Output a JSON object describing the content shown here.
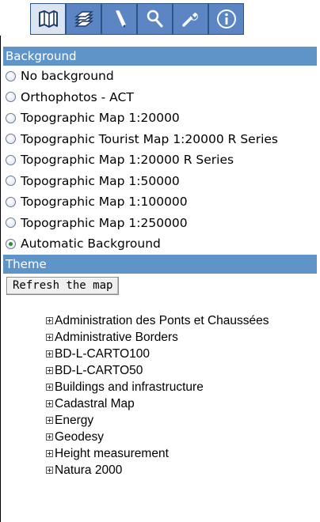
{
  "toolbar": {
    "tabs": [
      {
        "icon": "map-icon",
        "active": true
      },
      {
        "icon": "layers-icon",
        "active": false
      },
      {
        "icon": "pencil-icon",
        "active": false
      },
      {
        "icon": "search-icon",
        "active": false
      },
      {
        "icon": "wrench-icon",
        "active": false
      },
      {
        "icon": "info-icon",
        "active": false
      }
    ]
  },
  "background": {
    "header": "Background",
    "options": [
      {
        "label": "No background",
        "checked": false
      },
      {
        "label": "Orthophotos - ACT",
        "checked": false
      },
      {
        "label": "Topographic Map 1:20000",
        "checked": false
      },
      {
        "label": "Topographic Tourist Map 1:20000 R Series",
        "checked": false
      },
      {
        "label": "Topographic Map 1:20000 R Series",
        "checked": false
      },
      {
        "label": "Topographic Map 1:50000",
        "checked": false
      },
      {
        "label": "Topographic Map 1:100000",
        "checked": false
      },
      {
        "label": "Topographic Map 1:250000",
        "checked": false
      },
      {
        "label": "Automatic Background",
        "checked": true
      }
    ]
  },
  "theme": {
    "header": "Theme",
    "refresh_label": "Refresh the map",
    "items": [
      {
        "label": "Administration des Ponts et Chaussées"
      },
      {
        "label": "Administrative Borders"
      },
      {
        "label": "BD-L-CARTO100"
      },
      {
        "label": "BD-L-CARTO50"
      },
      {
        "label": "Buildings and infrastructure"
      },
      {
        "label": "Cadastral Map"
      },
      {
        "label": "Energy"
      },
      {
        "label": "Geodesy"
      },
      {
        "label": "Height measurement"
      },
      {
        "label": "Natura 2000"
      }
    ]
  },
  "colors": {
    "tab_bg": "#5b86c3",
    "tab_active_bg": "#dbe5f1",
    "header_bg": "#5f94c8",
    "radio_checked": "#2d8a2d"
  }
}
